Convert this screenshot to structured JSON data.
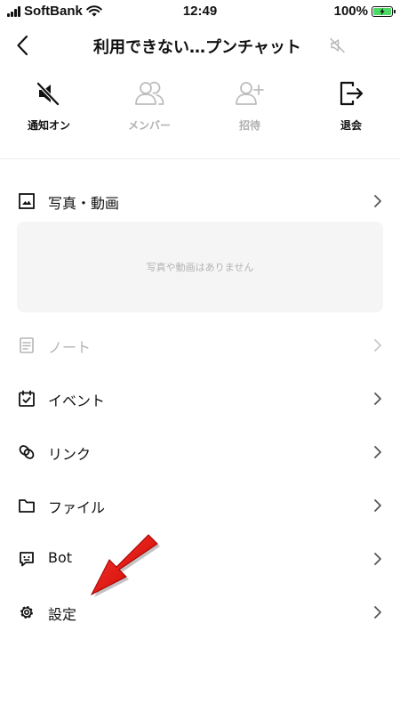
{
  "status": {
    "carrier": "SoftBank",
    "time": "12:49",
    "battery": "100%"
  },
  "header": {
    "back_icon": "chevron-left-icon",
    "title": "利用できない…プンチャット",
    "mute_icon": "speaker-muted-icon"
  },
  "actions": [
    {
      "label": "通知オン",
      "icon": "speaker-off-icon",
      "enabled": true
    },
    {
      "label": "メンバー",
      "icon": "members-icon",
      "enabled": false
    },
    {
      "label": "招待",
      "icon": "add-person-icon",
      "enabled": false
    },
    {
      "label": "退会",
      "icon": "exit-icon",
      "enabled": true
    }
  ],
  "media": {
    "label": "写真・動画",
    "empty_text": "写真や動画はありません"
  },
  "menu": [
    {
      "label": "ノート",
      "icon": "note-icon",
      "enabled": false
    },
    {
      "label": "イベント",
      "icon": "calendar-check-icon",
      "enabled": true
    },
    {
      "label": "リンク",
      "icon": "link-icon",
      "enabled": true
    },
    {
      "label": "ファイル",
      "icon": "folder-icon",
      "enabled": true
    },
    {
      "label": "Bot",
      "icon": "bot-icon",
      "enabled": true
    },
    {
      "label": "設定",
      "icon": "gear-icon",
      "enabled": true
    }
  ],
  "colors": {
    "accent_arrow": "#e60012",
    "disabled": "#b3b3b3",
    "battery_fill": "#4cd964"
  }
}
